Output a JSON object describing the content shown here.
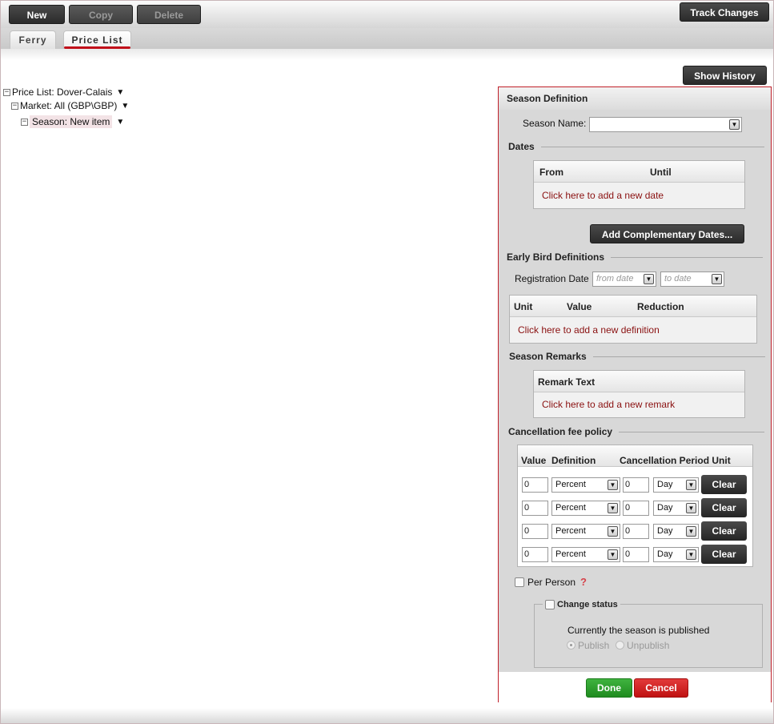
{
  "toolbar": {
    "new_label": "New",
    "copy_label": "Copy",
    "delete_label": "Delete",
    "track_changes_label": "Track Changes"
  },
  "tabs": [
    {
      "label": "Ferry"
    },
    {
      "label": "Price List"
    }
  ],
  "history_button": "Show History",
  "tree": {
    "price_list": "Price List: Dover-Calais",
    "market": "Market: All (GBP\\GBP)",
    "season": "Season: New item",
    "collapse_glyph": "⊟",
    "caret": "▼"
  },
  "panel": {
    "title": "Season Definition",
    "season_name_label": "Season Name:",
    "season_name_value": "",
    "dates": {
      "title": "Dates",
      "columns": [
        "From",
        "Until"
      ],
      "add_link": "Click here to add a new date",
      "complementary_button": "Add Complementary Dates..."
    },
    "early_bird": {
      "title": "Early Bird Definitions",
      "registration_label": "Registration Date",
      "from_placeholder": "from date",
      "to_placeholder": "to date",
      "columns": [
        "Unit",
        "Value",
        "Reduction"
      ],
      "add_link": "Click here to add a new definition"
    },
    "remarks": {
      "title": "Season Remarks",
      "column": "Remark Text",
      "add_link": "Click here to add a new remark"
    },
    "cancellation": {
      "title": "Cancellation fee policy",
      "columns": [
        "Value",
        "Definition",
        "Cancellation Period Unit"
      ],
      "rows": [
        {
          "value": "0",
          "definition": "Percent",
          "period": "0",
          "unit": "Day"
        },
        {
          "value": "0",
          "definition": "Percent",
          "period": "0",
          "unit": "Day"
        },
        {
          "value": "0",
          "definition": "Percent",
          "period": "0",
          "unit": "Day"
        },
        {
          "value": "0",
          "definition": "Percent",
          "period": "0",
          "unit": "Day"
        }
      ],
      "clear_label": "Clear"
    },
    "per_person_label": "Per Person",
    "help_glyph": "?",
    "status": {
      "legend": "Change status",
      "current": "Currently the season is published",
      "publish_label": "Publish",
      "unpublish_label": "Unpublish"
    },
    "done_label": "Done",
    "cancel_label": "Cancel"
  },
  "colors": {
    "accent_red": "#c0101a",
    "done_green": "#2a9d2a",
    "cancel_red": "#d01c1c",
    "link": "#8a1010"
  },
  "icons": {
    "dropdown": "chevron-down-icon",
    "collapse": "collapse-icon",
    "help": "question-mark-icon"
  }
}
